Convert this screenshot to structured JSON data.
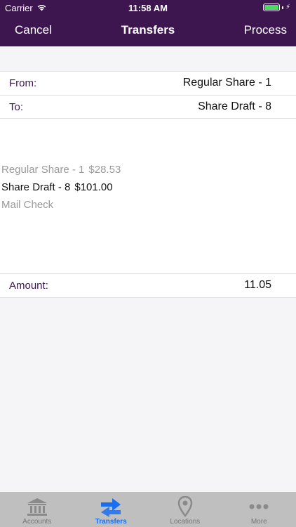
{
  "status_bar": {
    "carrier": "Carrier",
    "time": "11:58 AM"
  },
  "nav": {
    "cancel_label": "Cancel",
    "title": "Transfers",
    "process_label": "Process"
  },
  "form": {
    "from_label": "From:",
    "from_value": "Regular Share - 1",
    "to_label": "To:",
    "to_value": "Share Draft - 8",
    "amount_label": "Amount:",
    "amount_value": "11.05"
  },
  "accounts": [
    {
      "name": "Regular Share - 1",
      "amount": "$28.53"
    },
    {
      "name": "Share Draft - 8",
      "amount": "$101.00"
    },
    {
      "name": "Mail Check",
      "amount": ""
    }
  ],
  "tabs": [
    {
      "label": "Accounts",
      "icon": "bank-icon"
    },
    {
      "label": "Transfers",
      "icon": "transfer-arrows-icon"
    },
    {
      "label": "Locations",
      "icon": "location-pin-icon"
    },
    {
      "label": "More",
      "icon": "more-dots-icon"
    }
  ],
  "colors": {
    "header": "#3d1650",
    "label_purple": "#3d1650",
    "tab_active": "#1a6ff0",
    "battery": "#4cd964"
  }
}
